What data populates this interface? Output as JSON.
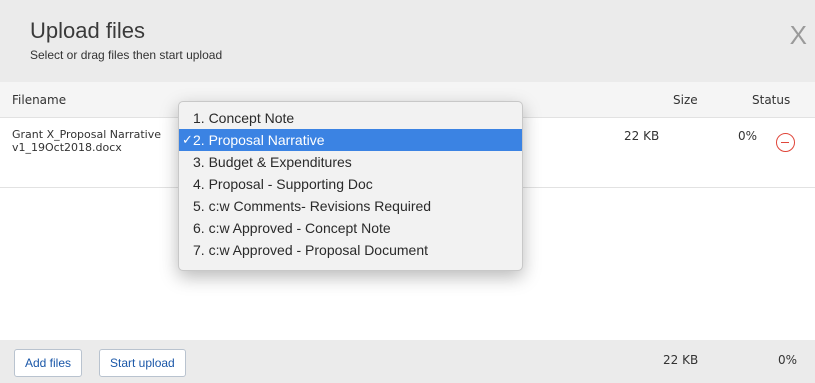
{
  "dialog": {
    "title": "Upload files",
    "subtitle": "Select or drag files then start upload",
    "close_label": "X"
  },
  "table": {
    "headers": {
      "filename": "Filename",
      "size": "Size",
      "status": "Status"
    },
    "rows": [
      {
        "filename": "Grant X_Proposal Narrative v1_19Oct2018.docx",
        "size": "22 KB",
        "status": "0%"
      }
    ]
  },
  "dropdown": {
    "options": [
      "1. Concept Note",
      "2. Proposal Narrative",
      "3. Budget & Expenditures",
      "4. Proposal - Supporting Doc",
      "5. c:w Comments- Revisions Required",
      "6. c:w Approved - Concept Note",
      "7. c:w Approved - Proposal Document"
    ],
    "selected_index": 1,
    "check_mark": "✓"
  },
  "footer": {
    "add_files_label": "Add files",
    "start_upload_label": "Start upload",
    "total_size": "22 KB",
    "total_status": "0%"
  },
  "colors": {
    "header_bg": "#ebebeb",
    "accent_blue": "#1a57a8",
    "selection_blue": "#3b83e3",
    "remove_red": "#e0463a"
  }
}
